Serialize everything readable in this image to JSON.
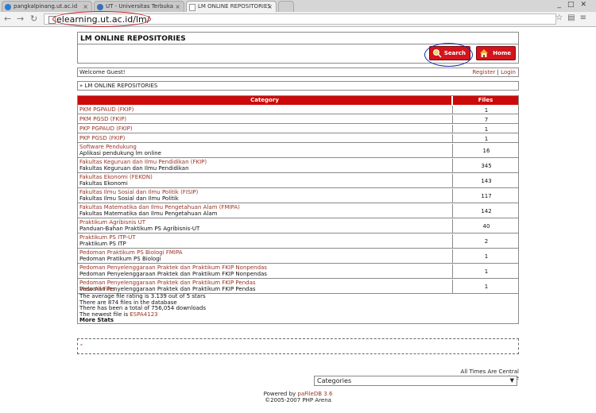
{
  "browser": {
    "tabs": [
      {
        "label": "pangkalpinang.ut.ac.id",
        "fav_color": "#2b7bd6"
      },
      {
        "label": "UT - Universitas Terbuka",
        "fav_color": "#3a6fb8"
      },
      {
        "label": "LM ONLINE REPOSITORIES",
        "fav_color": "#ffffff"
      }
    ],
    "url": "elearning.ut.ac.id/lm/",
    "highlight_color": "#c0171d"
  },
  "header": {
    "title": "LM ONLINE REPOSITORIES",
    "search_label": "Search",
    "home_label": "Home"
  },
  "welcome": {
    "text": "Welcome Guest!",
    "register": "Register",
    "separator": "|",
    "login": "Login"
  },
  "breadcrumb": "» LM ONLINE REPOSITORIES",
  "table": {
    "headers": [
      "Category",
      "Files"
    ],
    "header_color": "#cc0a0a",
    "rows": [
      {
        "name": "PKM PGPAUD (FKIP)",
        "desc": "",
        "files": "1"
      },
      {
        "name": "PKM PGSD (FKIP)",
        "desc": "",
        "files": "7"
      },
      {
        "name": "PKP PGPAUD (FKIP)",
        "desc": "",
        "files": "1"
      },
      {
        "name": "PKP PGSD (FKIP)",
        "desc": "",
        "files": "1"
      },
      {
        "name": "Software Pendukung",
        "desc": "Aplikasi pendukung lm online",
        "files": "16"
      },
      {
        "name": "Fakultas Keguruan dan Ilmu Pendidikan (FKIP)",
        "desc": "Fakultas Keguruan dan Ilmu Pendidikan",
        "files": "345"
      },
      {
        "name": "Fakultas Ekonomi (FEKON)",
        "desc": "Fakultas Ekonomi",
        "files": "143"
      },
      {
        "name": "Fakultas Ilmu Sosial dan Ilmu Politik (FISIP)",
        "desc": "Fakultas Ilmu Sosial dan Ilmu Politik",
        "files": "117"
      },
      {
        "name": "Fakultas Matematika dan Ilmu Pengetahuan Alam (FMIPA)",
        "desc": "Fakultas Matematika dan Ilmu Pengetahuan Alam",
        "files": "142"
      },
      {
        "name": "Praktikum Agribisnis UT",
        "desc": "Panduan-Bahan Praktikum PS Agribisnis-UT",
        "files": "40"
      },
      {
        "name": "Praktikum PS ITP-UT",
        "desc": "Praktikum PS ITP",
        "files": "2"
      },
      {
        "name": "Pedoman Praktikum PS Biologi FMIPA",
        "desc": "Pedoman Pratikum PS Biologi",
        "files": "1"
      },
      {
        "name": "Pedoman Penyelenggaraan Praktek dan Praktikum FKIP Nonpendas",
        "desc": "Pedoman Penyelenggaraan Praktek dan Praktikum FKIP Nonpendas",
        "files": "1"
      },
      {
        "name": "Pedoman Penyelenggaraan Praktek dan Praktikum FKIP Pendas",
        "desc": "Pedoman Penyelenggaraan Praktek dan Praktikum FKIP Pendas",
        "files": "1"
      }
    ],
    "view_all": "View All Files"
  },
  "stats": {
    "rating": "The average file rating is 3.139 out of 5 stars",
    "files": "There are 874 files in the database",
    "downloads": "There has been a total of 756,054 downloads",
    "newest_prefix": "The newest file is",
    "newest_file": "ESPA4123",
    "more": "More Stats"
  },
  "dashed_box_text": "-",
  "footer": {
    "timezone": "All Times Are Central Time",
    "select_value": "Categories",
    "powered_prefix": "Powered by",
    "powered_name": "paFileDB 3.6",
    "copyright": "©2005-2007 PHP Arena"
  }
}
